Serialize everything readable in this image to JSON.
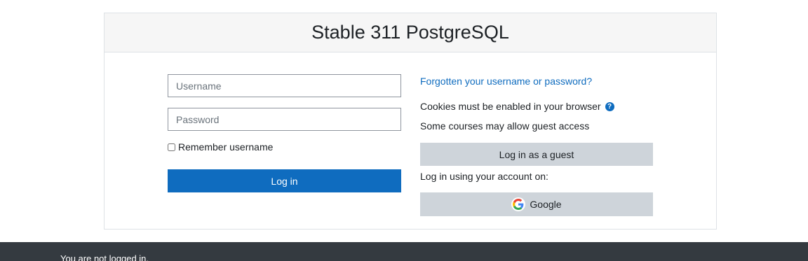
{
  "login": {
    "site_title": "Stable 311 PostgreSQL",
    "username_placeholder": "Username",
    "password_placeholder": "Password",
    "remember_label": "Remember username",
    "login_button": "Log in",
    "forgot_link": "Forgotten your username or password?",
    "cookies_text": "Cookies must be enabled in your browser",
    "guest_access_text": "Some courses may allow guest access",
    "guest_button": "Log in as a guest",
    "account_text": "Log in using your account on:",
    "google_button": "Google"
  },
  "footer": {
    "status_text": "You are not logged in."
  },
  "icons": {
    "help": "question-circle-icon",
    "google": "google-logo-icon"
  },
  "colors": {
    "primary": "#0f6cbf",
    "secondary_button": "#ced4da",
    "footer_bg": "#343a40",
    "header_bg": "#f6f6f6"
  }
}
